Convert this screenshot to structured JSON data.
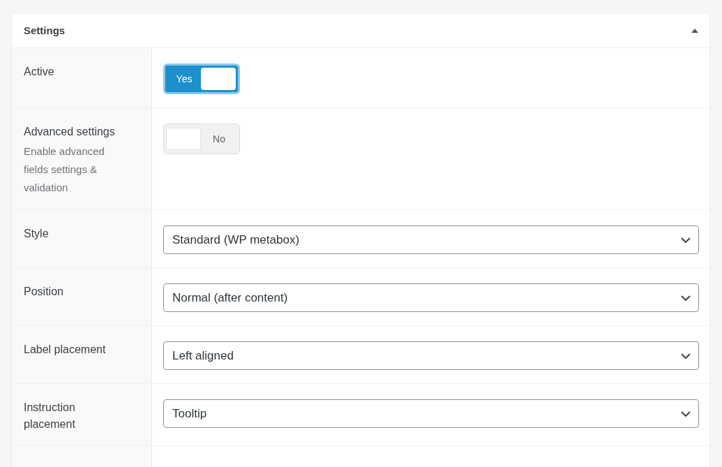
{
  "panel": {
    "title": "Settings",
    "expanded": true
  },
  "fields": [
    {
      "kind": "toggle",
      "label": "Active",
      "on": true,
      "text": "Yes"
    },
    {
      "kind": "toggle",
      "label": "Advanced settings",
      "description": "Enable advanced fields settings & validation",
      "on": false,
      "text": "No"
    },
    {
      "kind": "select",
      "label": "Style",
      "value": "Standard (WP metabox)"
    },
    {
      "kind": "select",
      "label": "Position",
      "value": "Normal (after content)"
    },
    {
      "kind": "select",
      "label": "Label placement",
      "value": "Left aligned"
    },
    {
      "kind": "select",
      "label": "Instruction placement",
      "value": "Tooltip"
    }
  ]
}
